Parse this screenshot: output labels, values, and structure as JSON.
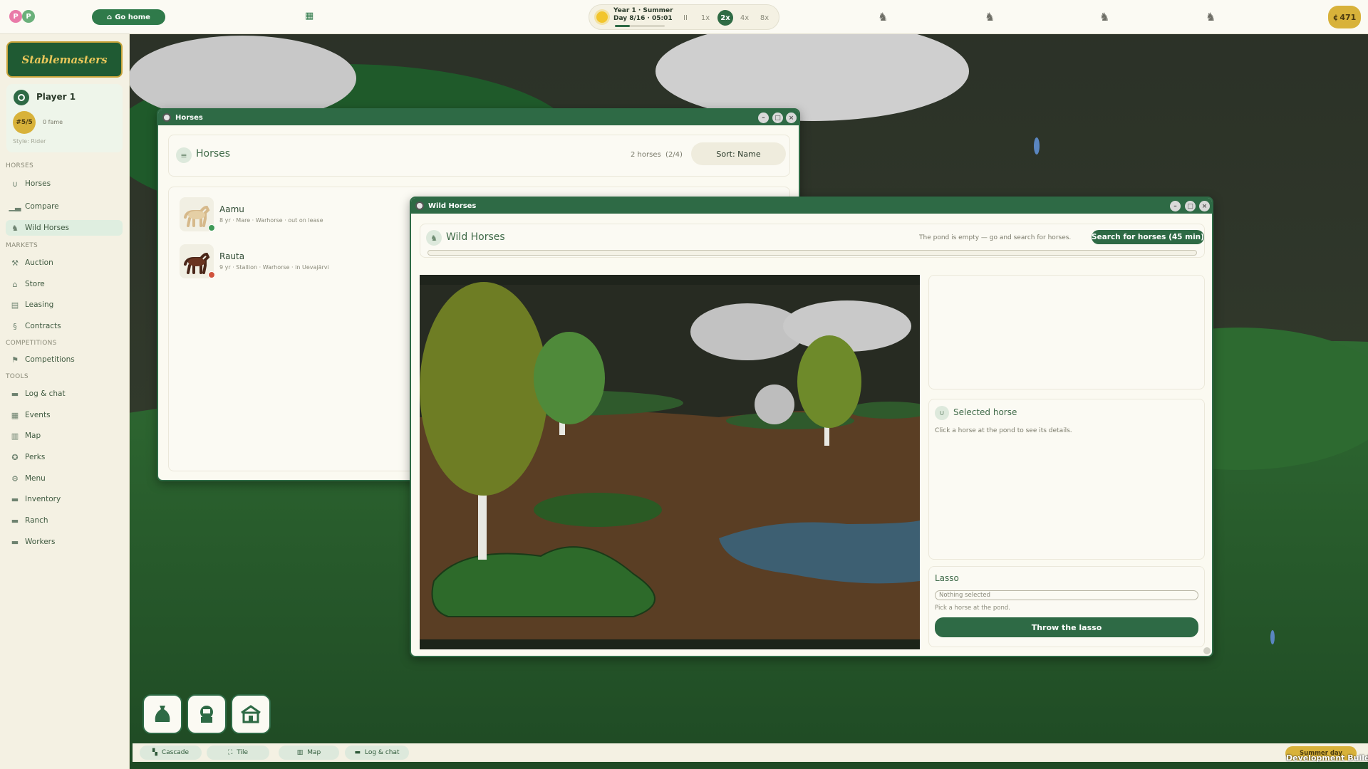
{
  "topbar": {
    "avatars": [
      "P",
      "P"
    ],
    "go_home_label": "Go home",
    "time": {
      "line1": "Year 1 · Summer",
      "line2": "Day 8/16 · 05:01",
      "progress": 0.3
    },
    "speeds": [
      "II",
      "1x",
      "2x",
      "4x",
      "8x"
    ],
    "active_speed": "2x",
    "coins": "471"
  },
  "sidebar": {
    "logo": "Stablemasters",
    "player": {
      "name": "Player 1",
      "rank": "#5/5",
      "fame": "0 fame",
      "style": "Style: Rider"
    },
    "sections": {
      "horses": "HORSES",
      "markets": "MARKETS",
      "competitions": "COMPETITIONS",
      "tools": "TOOLS"
    },
    "items": [
      {
        "label": "Horses"
      },
      {
        "label": "Compare"
      },
      {
        "label": "Wild Horses"
      },
      {
        "label": "Auction"
      },
      {
        "label": "Store"
      },
      {
        "label": "Leasing"
      },
      {
        "label": "Contracts"
      },
      {
        "label": "Competitions"
      },
      {
        "label": "Log & chat"
      },
      {
        "label": "Events"
      },
      {
        "label": "Map"
      },
      {
        "label": "Perks"
      },
      {
        "label": "Menu"
      },
      {
        "label": "Inventory"
      },
      {
        "label": "Ranch"
      },
      {
        "label": "Workers"
      }
    ]
  },
  "horses_window": {
    "title": "Horses",
    "header": "Horses",
    "count": "2 horses",
    "capacity": "(2/4)",
    "sort_label": "Sort: Name",
    "horses": [
      {
        "name": "Aamu",
        "age": "8 yr",
        "sex": "Mare",
        "breed": "Warhorse",
        "status": "out on lease"
      },
      {
        "name": "Rauta",
        "age": "9 yr",
        "sex": "Stallion",
        "breed": "Warhorse",
        "status": "in Uevajärvi"
      }
    ]
  },
  "wild_window": {
    "title": "Wild Horses",
    "header": "Wild Horses",
    "empty_msg": "The pond is empty — go and search for horses.",
    "search_label": "Search for horses (45 min)",
    "selected_title": "Selected horse",
    "selected_hint": "Click a horse at the pond to see its details.",
    "lasso_title": "Lasso",
    "lasso_value": "Nothing selected",
    "lasso_hint": "Pick a horse at the pond.",
    "throw_label": "Throw the lasso"
  },
  "bottombar": {
    "buttons": [
      "Cascade",
      "Tile",
      "Map",
      "Log & chat"
    ],
    "season": "Summer day",
    "build": "Development Build"
  },
  "colors": {
    "accent": "#2e6a45",
    "gold": "#d8b23a",
    "status_green": "#3f9a56",
    "status_red": "#d0533d"
  }
}
